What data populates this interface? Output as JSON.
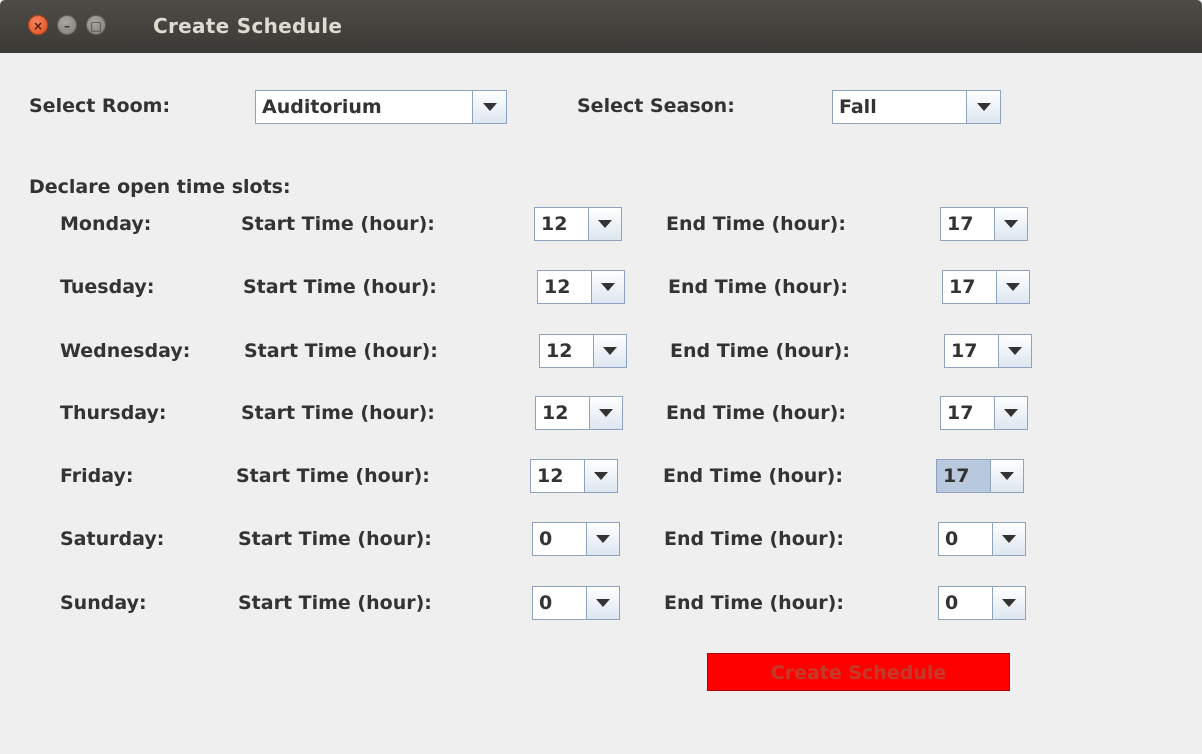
{
  "window": {
    "title": "Create Schedule",
    "close_glyph": "×",
    "min_glyph": "–",
    "max_glyph": "□"
  },
  "room": {
    "label": "Select Room:",
    "value": "Auditorium"
  },
  "season": {
    "label": "Select Season:",
    "value": "Fall"
  },
  "slots_header": "Declare open time slots:",
  "start_label": "Start Time (hour):",
  "end_label": "End Time (hour):",
  "days": [
    {
      "name": "Monday:",
      "start": "12",
      "end": "17"
    },
    {
      "name": "Tuesday:",
      "start": "12",
      "end": "17"
    },
    {
      "name": "Wednesday:",
      "start": "12",
      "end": "17"
    },
    {
      "name": "Thursday:",
      "start": "12",
      "end": "17"
    },
    {
      "name": "Friday:",
      "start": "12",
      "end": "17"
    },
    {
      "name": "Saturday:",
      "start": "0",
      "end": "0"
    },
    {
      "name": "Sunday:",
      "start": "0",
      "end": "0"
    }
  ],
  "create_button": "Create Schedule",
  "colors": {
    "titlebar": "#3b3a36",
    "window_bg": "#efefef",
    "create_button_bg": "#ff0000",
    "selected_value_bg": "#b8c9de"
  }
}
